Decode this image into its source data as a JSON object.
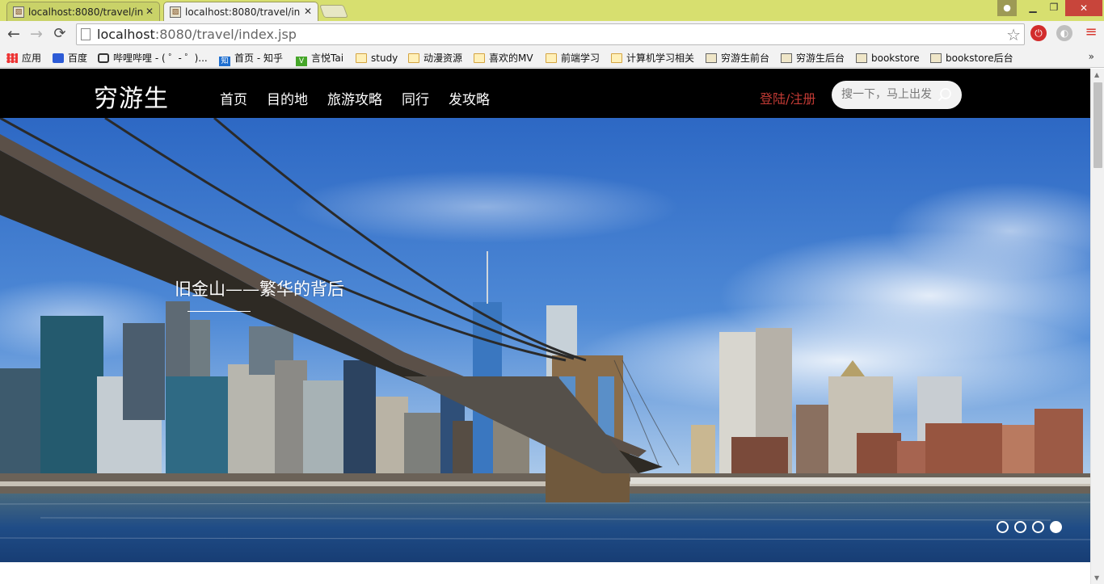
{
  "browser": {
    "tabs": [
      {
        "title": "localhost:8080/travel/in",
        "favicon": "page-favicon-icon"
      },
      {
        "title": "localhost:8080/travel/in",
        "favicon": "page-favicon-icon"
      }
    ],
    "url_host": "localhost",
    "url_rest": ":8080/travel/index.jsp",
    "bookmarks": [
      {
        "label": "应用",
        "icon": "apps-icon"
      },
      {
        "label": "百度",
        "icon": "paw-icon"
      },
      {
        "label": "哔哩哔哩 - ( ゜- ゜)...",
        "icon": "tv-icon"
      },
      {
        "label": "首页 - 知乎",
        "icon": "zhihu-icon"
      },
      {
        "label": "言悦Tai",
        "icon": "green-icon"
      },
      {
        "label": "study",
        "icon": "folder-icon"
      },
      {
        "label": "动漫资源",
        "icon": "folder-icon"
      },
      {
        "label": "喜欢的MV",
        "icon": "folder-icon"
      },
      {
        "label": "前端学习",
        "icon": "folder-icon"
      },
      {
        "label": "计算机学习相关",
        "icon": "folder-icon"
      },
      {
        "label": "穷游生前台",
        "icon": "image-icon"
      },
      {
        "label": "穷游生后台",
        "icon": "image-icon"
      },
      {
        "label": "bookstore",
        "icon": "image-icon"
      },
      {
        "label": "bookstore后台",
        "icon": "image-icon"
      }
    ],
    "bookmarks_more": "»"
  },
  "site": {
    "logo": "穷游生",
    "nav": [
      "首页",
      "目的地",
      "旅游攻略",
      "同行",
      "发攻略"
    ],
    "login": "登陆/注册",
    "search_placeholder": "搜一下，马上出发"
  },
  "hero": {
    "caption": "旧金山——繁华的背后",
    "slide_count": 4,
    "active_slide": 4
  },
  "colors": {
    "tabstrip": "#d7df6f",
    "header_bg": "#000000",
    "login_red": "#c13a34",
    "close_red": "#c8453b"
  }
}
